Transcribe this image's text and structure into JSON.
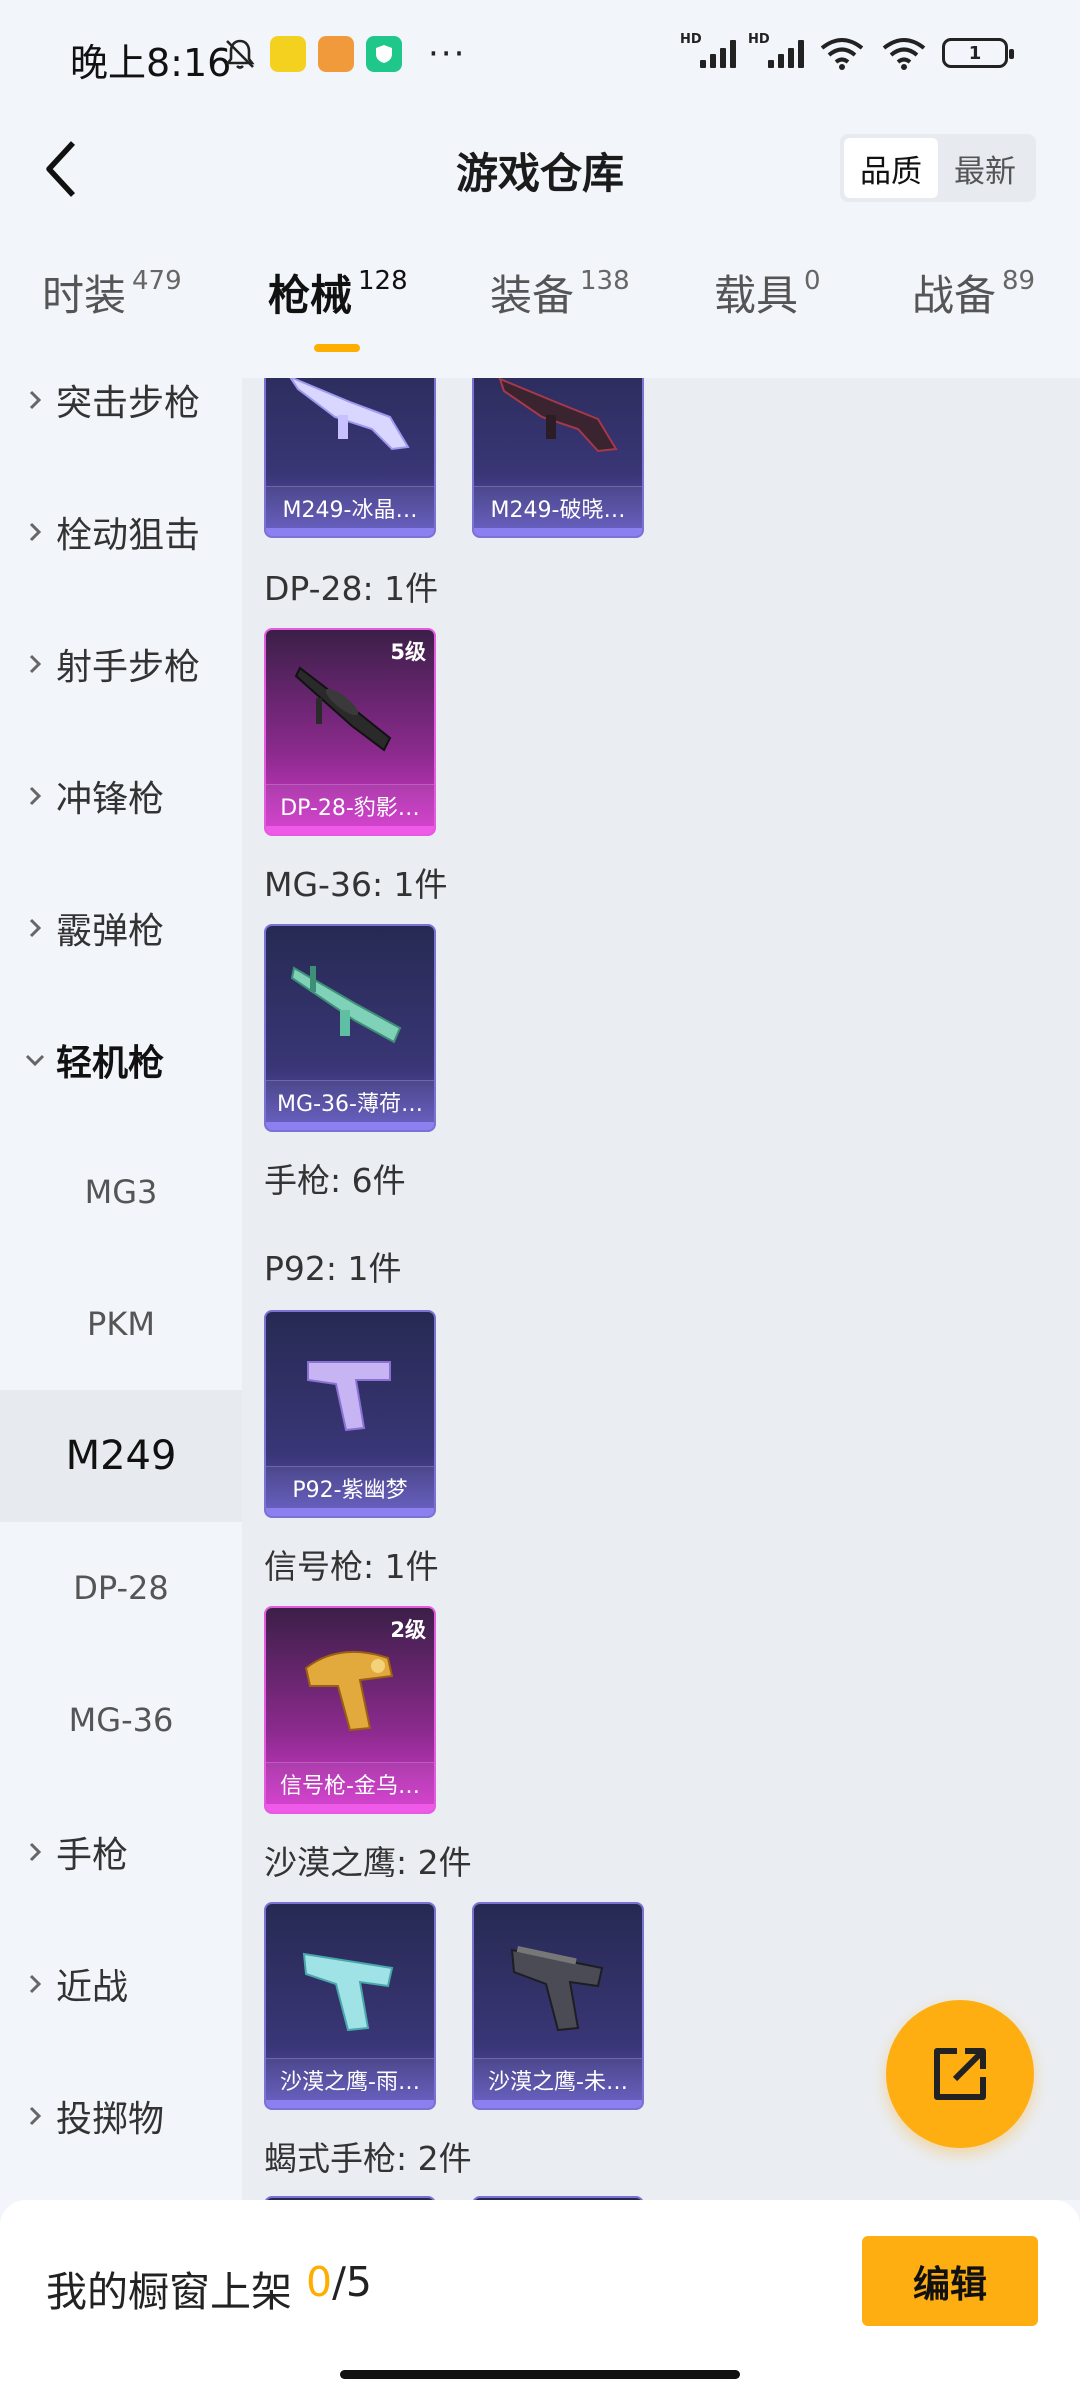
{
  "status_bar": {
    "time": "晚上8:16",
    "battery": "1",
    "network_badge": "HD",
    "icons": [
      "bell-off-icon",
      "app-badge-icon",
      "app-badge-icon",
      "shield-app-icon",
      "more-dots-icon",
      "signal-icon",
      "signal-icon",
      "wifi-icon",
      "wifi-icon",
      "battery-icon"
    ]
  },
  "header": {
    "title": "游戏仓库",
    "sort_options": [
      "品质",
      "最新"
    ],
    "active_sort": "品质"
  },
  "tabs": [
    {
      "label": "时装",
      "count": "479"
    },
    {
      "label": "枪械",
      "count": "128"
    },
    {
      "label": "装备",
      "count": "138"
    },
    {
      "label": "载具",
      "count": "0"
    },
    {
      "label": "战备",
      "count": "89"
    }
  ],
  "active_tab": "枪械",
  "sidebar": {
    "categories": [
      "突击步枪",
      "栓动狙击",
      "射手步枪",
      "冲锋枪",
      "霰弹枪",
      "轻机枪",
      "手枪",
      "近战",
      "投掷物"
    ],
    "expanded": "轻机枪",
    "subitems": [
      "MG3",
      "PKM",
      "M249",
      "DP-28",
      "MG-36"
    ],
    "active_subitem": "M249"
  },
  "content": {
    "top_cards": [
      {
        "name": "M249-冰晶…"
      },
      {
        "name": "M249-破晓…"
      }
    ],
    "sections": [
      {
        "title": "DP-28: 1件",
        "cards": [
          {
            "name": "DP-28-豹影…",
            "level": "5级",
            "rarity": "pink"
          }
        ]
      },
      {
        "title": "MG-36: 1件",
        "cards": [
          {
            "name": "MG-36-薄荷…",
            "rarity": "purple"
          }
        ]
      },
      {
        "title": "手枪: 6件"
      },
      {
        "title": "P92: 1件",
        "cards": [
          {
            "name": "P92-紫幽梦",
            "rarity": "purple"
          }
        ]
      },
      {
        "title": "信号枪: 1件",
        "cards": [
          {
            "name": "信号枪-金乌…",
            "level": "2级",
            "rarity": "pink"
          }
        ]
      },
      {
        "title": "沙漠之鹰: 2件",
        "cards": [
          {
            "name": "沙漠之鹰-雨…",
            "rarity": "purple"
          },
          {
            "name": "沙漠之鹰-未…",
            "rarity": "purple"
          }
        ]
      },
      {
        "title": "蝎式手枪: 2件"
      }
    ]
  },
  "bottom_bar": {
    "showcase_label": "我的橱窗上架",
    "showcase_current": "0",
    "showcase_total": "/5",
    "edit_label": "编辑"
  },
  "colors": {
    "accent": "#ffae12",
    "purple_card": "#3a3677",
    "pink_card": "#8b2a8d"
  }
}
